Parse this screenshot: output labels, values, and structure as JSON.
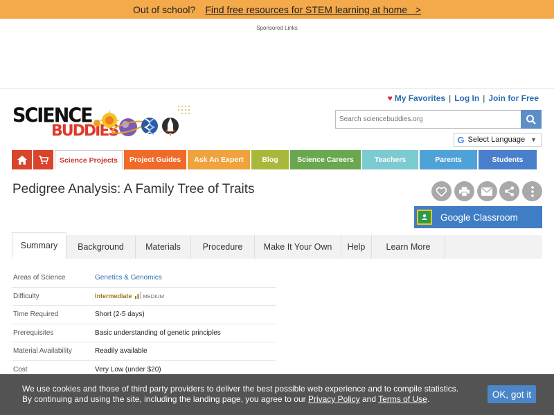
{
  "banner": {
    "question": "Out of school?",
    "link": "Find free resources for STEM learning at home",
    "arrow": ">"
  },
  "sponsored": "Sponsored Links",
  "user_links": {
    "favorites": "My Favorites",
    "login": "Log In",
    "join": "Join for Free",
    "separator": "|"
  },
  "logo": {
    "line1": "SCIENCE",
    "line2": "BUDDIES"
  },
  "search": {
    "placeholder": "Search sciencebuddies.org",
    "icon": "search-icon"
  },
  "language": {
    "g": "G",
    "label": "Select Language",
    "caret": "▼"
  },
  "nav": {
    "items": [
      {
        "label": "Science Projects",
        "color": "#ffffff"
      },
      {
        "label": "Project Guides",
        "color": "#f06a2a"
      },
      {
        "label": "Ask An Expert",
        "color": "#f0a23c"
      },
      {
        "label": "Blog",
        "color": "#a9b83a"
      },
      {
        "label": "Science Careers",
        "color": "#6aa84f"
      },
      {
        "label": "Teachers",
        "color": "#7ccbd0"
      },
      {
        "label": "Parents",
        "color": "#4fa2d8"
      },
      {
        "label": "Students",
        "color": "#4a7fcb"
      }
    ]
  },
  "page": {
    "title": "Pedigree Analysis: A Family Tree of Traits"
  },
  "share_icons": [
    "heart-icon",
    "print-icon",
    "email-icon",
    "share-icon",
    "more-icon"
  ],
  "google_classroom": {
    "label": "Google Classroom"
  },
  "tabs": [
    "Summary",
    "Background",
    "Materials",
    "Procedure",
    "Make It Your Own",
    "Help",
    "Learn More"
  ],
  "summary": {
    "rows": [
      {
        "key": "Areas of Science",
        "value": "Genetics & Genomics"
      },
      {
        "key": "Difficulty",
        "value": "Intermediate",
        "level": "MEDIUM"
      },
      {
        "key": "Time Required",
        "value": "Short (2-5 days)"
      },
      {
        "key": "Prerequisites",
        "value": "Basic understanding of genetic principles"
      },
      {
        "key": "Material Availability",
        "value": "Readily available"
      },
      {
        "key": "Cost",
        "value": "Very Low (under $20)"
      }
    ]
  },
  "cookie": {
    "line1": "We use cookies and those of third party providers to deliver the best possible web experience and to compile statistics.",
    "line2_pre": "By continuing and using the site, including the landing page, you agree to our",
    "privacy": "Privacy Policy",
    "and": "and",
    "terms": "Terms of Use",
    "end": ".",
    "ok": "OK, got it"
  }
}
